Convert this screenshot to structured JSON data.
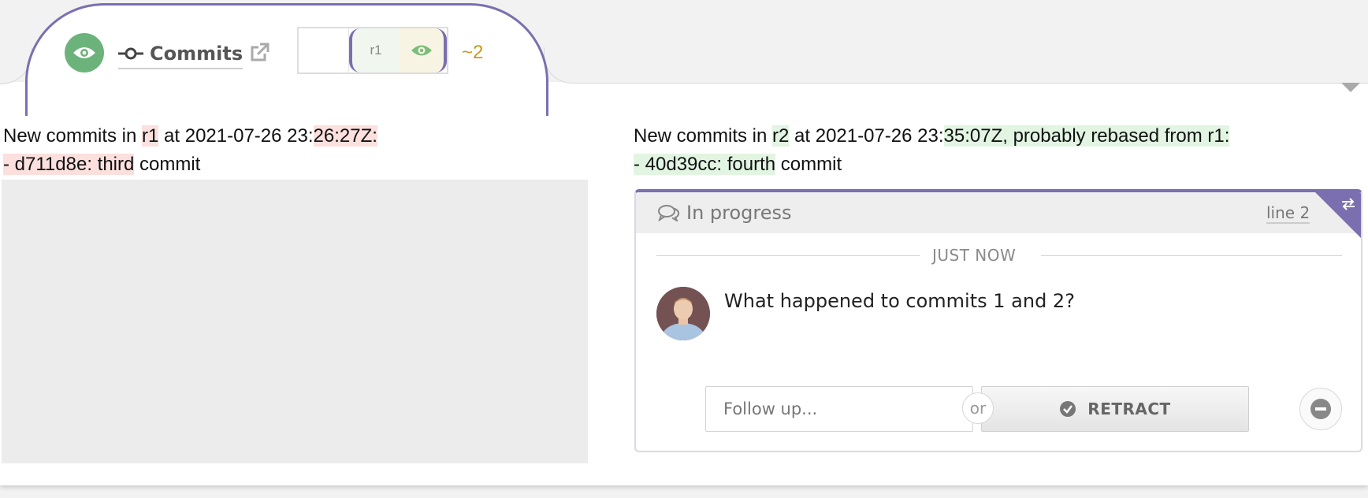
{
  "header": {
    "title": "Commits",
    "revision_label": "r1",
    "change_count": "~2"
  },
  "left": {
    "line1": {
      "a": "New commits in ",
      "b": "r1",
      "c": " at 2021-07-26 23:",
      "d": "26:27Z:"
    },
    "line2": {
      "a": "- d711d8e: third",
      "b": " commit"
    }
  },
  "right": {
    "line1": {
      "a": "New commits in ",
      "b": "r2",
      "c": " at 2021-07-26 23:",
      "d": "35:07Z, probably rebased from r1:"
    },
    "line2": {
      "a": "- 40d39cc: fourth",
      "b": " commit"
    }
  },
  "thread": {
    "status": "In progress",
    "line_ref": "line 2",
    "time": "JUST NOW",
    "comment": "What happened to commits 1 and 2?",
    "follow_placeholder": "Follow up...",
    "or_label": "or",
    "retract_label": "RETRACT"
  },
  "colors": {
    "accent": "#7b6fb0",
    "eye_green": "#6bb37a",
    "count_gold": "#c49a1c",
    "deleted_bg": "#fbe0de",
    "added_bg": "#e2f5e2"
  },
  "icons": [
    "eye-icon",
    "commit-icon",
    "external-link-icon",
    "comments-icon",
    "reply-arrow-icon",
    "check-circle-icon",
    "minus-circle-icon"
  ]
}
